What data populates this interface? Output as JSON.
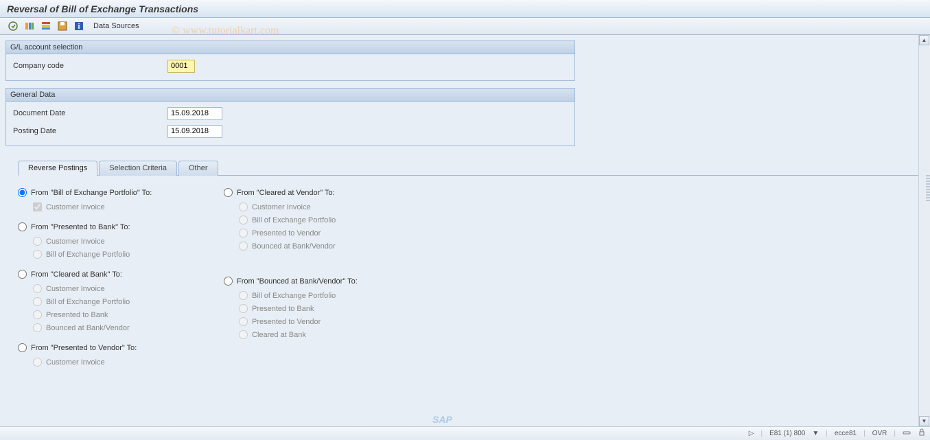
{
  "title": "Reversal of Bill of Exchange Transactions",
  "toolbar": {
    "data_sources": "Data Sources"
  },
  "watermark": "© www.tutorialkart.com",
  "groups": {
    "gl": {
      "title": "G/L account selection",
      "company_code_label": "Company code",
      "company_code_value": "0001"
    },
    "general": {
      "title": "General Data",
      "doc_date_label": "Document Date",
      "doc_date_value": "15.09.2018",
      "post_date_label": "Posting Date",
      "post_date_value": "15.09.2018"
    }
  },
  "tabs": {
    "reverse": "Reverse Postings",
    "selection": "Selection Criteria",
    "other": "Other"
  },
  "reversals": {
    "from_portfolio": {
      "title": "From \"Bill of Exchange Portfolio\" To:",
      "options": [
        "Customer Invoice"
      ]
    },
    "from_presented_bank": {
      "title": "From \"Presented to Bank\" To:",
      "options": [
        "Customer Invoice",
        "Bill of Exchange Portfolio"
      ]
    },
    "from_cleared_bank": {
      "title": "From \"Cleared at Bank\" To:",
      "options": [
        "Customer Invoice",
        "Bill of Exchange Portfolio",
        "Presented to Bank",
        "Bounced at Bank/Vendor"
      ]
    },
    "from_presented_vendor": {
      "title": "From \"Presented to Vendor\" To:",
      "options": [
        "Customer Invoice"
      ]
    },
    "from_cleared_vendor": {
      "title": "From \"Cleared at Vendor\" To:",
      "options": [
        "Customer Invoice",
        "Bill of Exchange Portfolio",
        "Presented to Vendor",
        "Bounced at Bank/Vendor"
      ]
    },
    "from_bounced": {
      "title": "From \"Bounced at Bank/Vendor\" To:",
      "options": [
        "Bill of Exchange Portfolio",
        "Presented to Bank",
        "Presented to Vendor",
        "Cleared at Bank"
      ]
    }
  },
  "status": {
    "sap": "SAP",
    "session": "E81 (1) 800",
    "server": "ecce81",
    "mode": "OVR"
  }
}
